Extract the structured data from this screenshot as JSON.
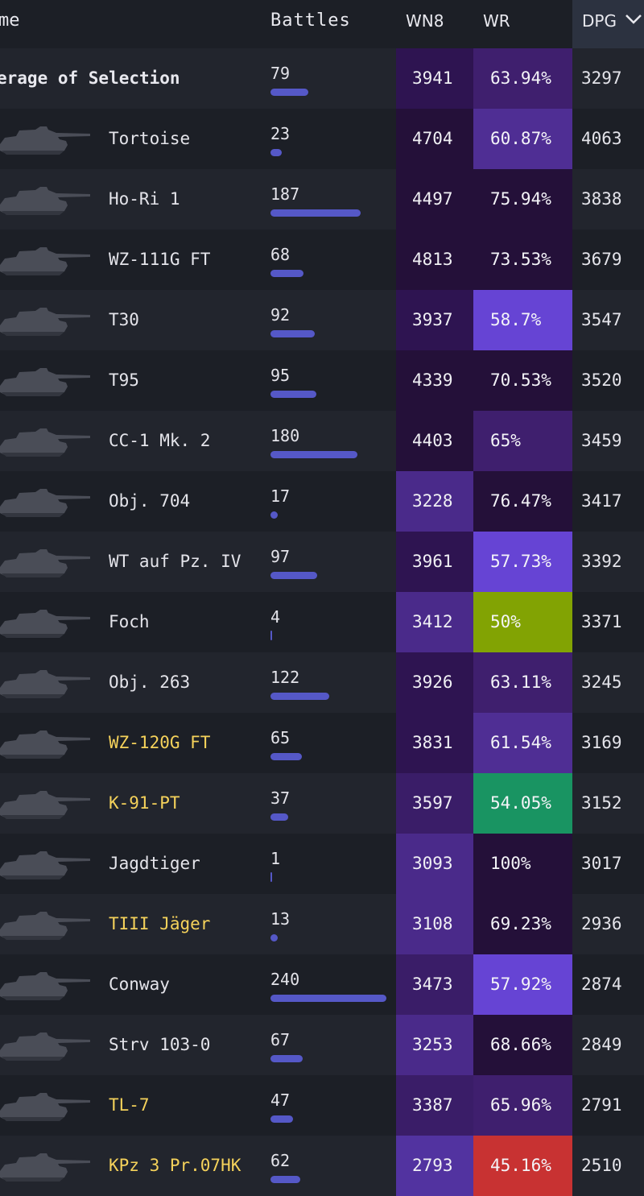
{
  "header": {
    "name": "me",
    "battles": "Battles",
    "wn8": "WN8",
    "wr": "WR",
    "dpg": "DPG"
  },
  "colors": {
    "wn8_super_unicum": "#241039",
    "wn8_unicum": "#2e1451",
    "wn8_great": "#4a2a8a",
    "wr_purple_dark": "#241039",
    "wr_purple": "#3f1f6e",
    "wr_purple_mid": "#4f2e94",
    "wr_purple_bright": "#6644d4",
    "wr_olive": "#82a303",
    "wr_green": "#199462",
    "wr_red": "#c83232",
    "premium_name": "#f5d25b",
    "battle_bar": "#5558c7"
  },
  "average": {
    "label": "erage of Selection",
    "battles": "79",
    "battles_num": 79,
    "wn8": "3941",
    "wr": "63.94%",
    "dpg": "3297",
    "wn8_color": "#2e1451",
    "wr_color": "#3f1f6e"
  },
  "rows": [
    {
      "name": "Tortoise",
      "premium": false,
      "battles": "23",
      "battles_num": 23,
      "wn8": "4704",
      "wr": "60.87%",
      "dpg": "4063",
      "wn8_color": "#241039",
      "wr_color": "#4f2e94",
      "icon": "tank-silhouette-icon"
    },
    {
      "name": "Ho-Ri 1",
      "premium": false,
      "battles": "187",
      "battles_num": 187,
      "wn8": "4497",
      "wr": "75.94%",
      "dpg": "3838",
      "wn8_color": "#241039",
      "wr_color": "#241039",
      "icon": "tank-silhouette-icon"
    },
    {
      "name": "WZ-111G FT",
      "premium": false,
      "battles": "68",
      "battles_num": 68,
      "wn8": "4813",
      "wr": "73.53%",
      "dpg": "3679",
      "wn8_color": "#241039",
      "wr_color": "#241039",
      "icon": "tank-silhouette-icon"
    },
    {
      "name": "T30",
      "premium": false,
      "battles": "92",
      "battles_num": 92,
      "wn8": "3937",
      "wr": "58.7%",
      "dpg": "3547",
      "wn8_color": "#2e1451",
      "wr_color": "#6644d4",
      "icon": "tank-silhouette-icon"
    },
    {
      "name": "T95",
      "premium": false,
      "battles": "95",
      "battles_num": 95,
      "wn8": "4339",
      "wr": "70.53%",
      "dpg": "3520",
      "wn8_color": "#241039",
      "wr_color": "#241039",
      "icon": "tank-silhouette-icon"
    },
    {
      "name": "CC-1 Mk. 2",
      "premium": false,
      "battles": "180",
      "battles_num": 180,
      "wn8": "4403",
      "wr": "65%",
      "dpg": "3459",
      "wn8_color": "#241039",
      "wr_color": "#3f1f6e",
      "icon": "tank-silhouette-icon"
    },
    {
      "name": "Obj. 704",
      "premium": false,
      "battles": "17",
      "battles_num": 17,
      "wn8": "3228",
      "wr": "76.47%",
      "dpg": "3417",
      "wn8_color": "#4a2a8a",
      "wr_color": "#241039",
      "icon": "tank-silhouette-icon"
    },
    {
      "name": "WT auf Pz. IV",
      "premium": false,
      "battles": "97",
      "battles_num": 97,
      "wn8": "3961",
      "wr": "57.73%",
      "dpg": "3392",
      "wn8_color": "#2e1451",
      "wr_color": "#6644d4",
      "icon": "tank-silhouette-icon"
    },
    {
      "name": "Foch",
      "premium": false,
      "battles": "4",
      "battles_num": 4,
      "wn8": "3412",
      "wr": "50%",
      "dpg": "3371",
      "wn8_color": "#4a2a8a",
      "wr_color": "#82a303",
      "icon": "tank-silhouette-icon"
    },
    {
      "name": "Obj. 263",
      "premium": false,
      "battles": "122",
      "battles_num": 122,
      "wn8": "3926",
      "wr": "63.11%",
      "dpg": "3245",
      "wn8_color": "#2e1451",
      "wr_color": "#3f1f6e",
      "icon": "tank-silhouette-icon"
    },
    {
      "name": "WZ-120G FT",
      "premium": true,
      "battles": "65",
      "battles_num": 65,
      "wn8": "3831",
      "wr": "61.54%",
      "dpg": "3169",
      "wn8_color": "#2e1451",
      "wr_color": "#4f2e94",
      "icon": "tank-silhouette-icon"
    },
    {
      "name": "K-91-PT",
      "premium": true,
      "battles": "37",
      "battles_num": 37,
      "wn8": "3597",
      "wr": "54.05%",
      "dpg": "3152",
      "wn8_color": "#3a1d68",
      "wr_color": "#199462",
      "icon": "tank-silhouette-icon"
    },
    {
      "name": "Jagdtiger",
      "premium": false,
      "battles": "1",
      "battles_num": 1,
      "wn8": "3093",
      "wr": "100%",
      "dpg": "3017",
      "wn8_color": "#4a2a8a",
      "wr_color": "#241039",
      "icon": "tank-silhouette-icon"
    },
    {
      "name": "TIII Jäger",
      "premium": true,
      "battles": "13",
      "battles_num": 13,
      "wn8": "3108",
      "wr": "69.23%",
      "dpg": "2936",
      "wn8_color": "#4a2a8a",
      "wr_color": "#241039",
      "icon": "tank-silhouette-icon"
    },
    {
      "name": "Conway",
      "premium": false,
      "battles": "240",
      "battles_num": 240,
      "wn8": "3473",
      "wr": "57.92%",
      "dpg": "2874",
      "wn8_color": "#3a1d68",
      "wr_color": "#6644d4",
      "icon": "tank-silhouette-icon"
    },
    {
      "name": "Strv 103-0",
      "premium": false,
      "battles": "67",
      "battles_num": 67,
      "wn8": "3253",
      "wr": "68.66%",
      "dpg": "2849",
      "wn8_color": "#4a2a8a",
      "wr_color": "#241039",
      "icon": "tank-silhouette-icon"
    },
    {
      "name": "TL-7",
      "premium": true,
      "battles": "47",
      "battles_num": 47,
      "wn8": "3387",
      "wr": "65.96%",
      "dpg": "2791",
      "wn8_color": "#3a1d68",
      "wr_color": "#3f1f6e",
      "icon": "tank-silhouette-icon"
    },
    {
      "name": "KPz 3 Pr.07HK",
      "premium": true,
      "battles": "62",
      "battles_num": 62,
      "wn8": "2793",
      "wr": "45.16%",
      "dpg": "2510",
      "wn8_color": "#5233a0",
      "wr_color": "#c83232",
      "icon": "tank-silhouette-icon"
    }
  ],
  "battles_max": 240
}
